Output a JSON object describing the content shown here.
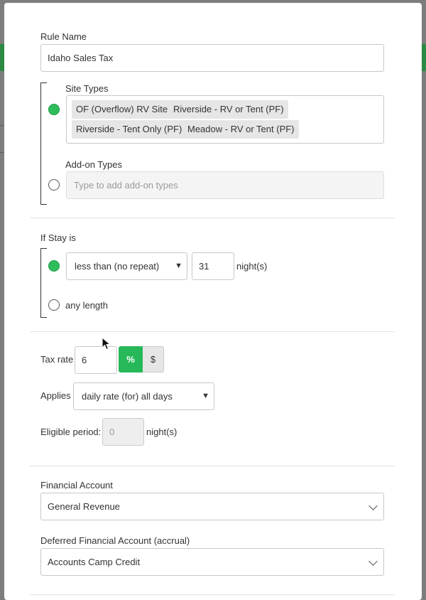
{
  "rule_name": {
    "label": "Rule Name",
    "value": "Idaho Sales Tax"
  },
  "site_types": {
    "label": "Site Types",
    "tags": [
      "OF (Overflow) RV Site",
      "Riverside - RV or Tent (PF)",
      "Riverside - Tent Only (PF)",
      "Meadow - RV or Tent (PF)"
    ]
  },
  "addon_types": {
    "label": "Add-on Types",
    "placeholder": "Type to add add-on types"
  },
  "stay": {
    "label": "If Stay is",
    "condition": "less than (no repeat)",
    "nights": "31",
    "nights_unit": "night(s)",
    "any_length": "any length"
  },
  "tax": {
    "label": "Tax rate",
    "value": "6",
    "percent": "%",
    "dollar": "$",
    "applies_label": "Applies",
    "applies_value": "daily rate (for) all days",
    "eligible_label": "Eligible period:",
    "eligible_value": "0",
    "eligible_unit": "night(s)"
  },
  "financial": {
    "label": "Financial Account",
    "value": "General Revenue",
    "deferred_label": "Deferred Financial Account (accrual)",
    "deferred_value": "Accounts Camp Credit"
  },
  "colors": {
    "accent": "#27b85a",
    "radio_on": "#2ebd5c",
    "overlay": "#7d7d7d"
  },
  "icons": [
    "chevron-down-icon",
    "mouse-cursor-icon"
  ]
}
